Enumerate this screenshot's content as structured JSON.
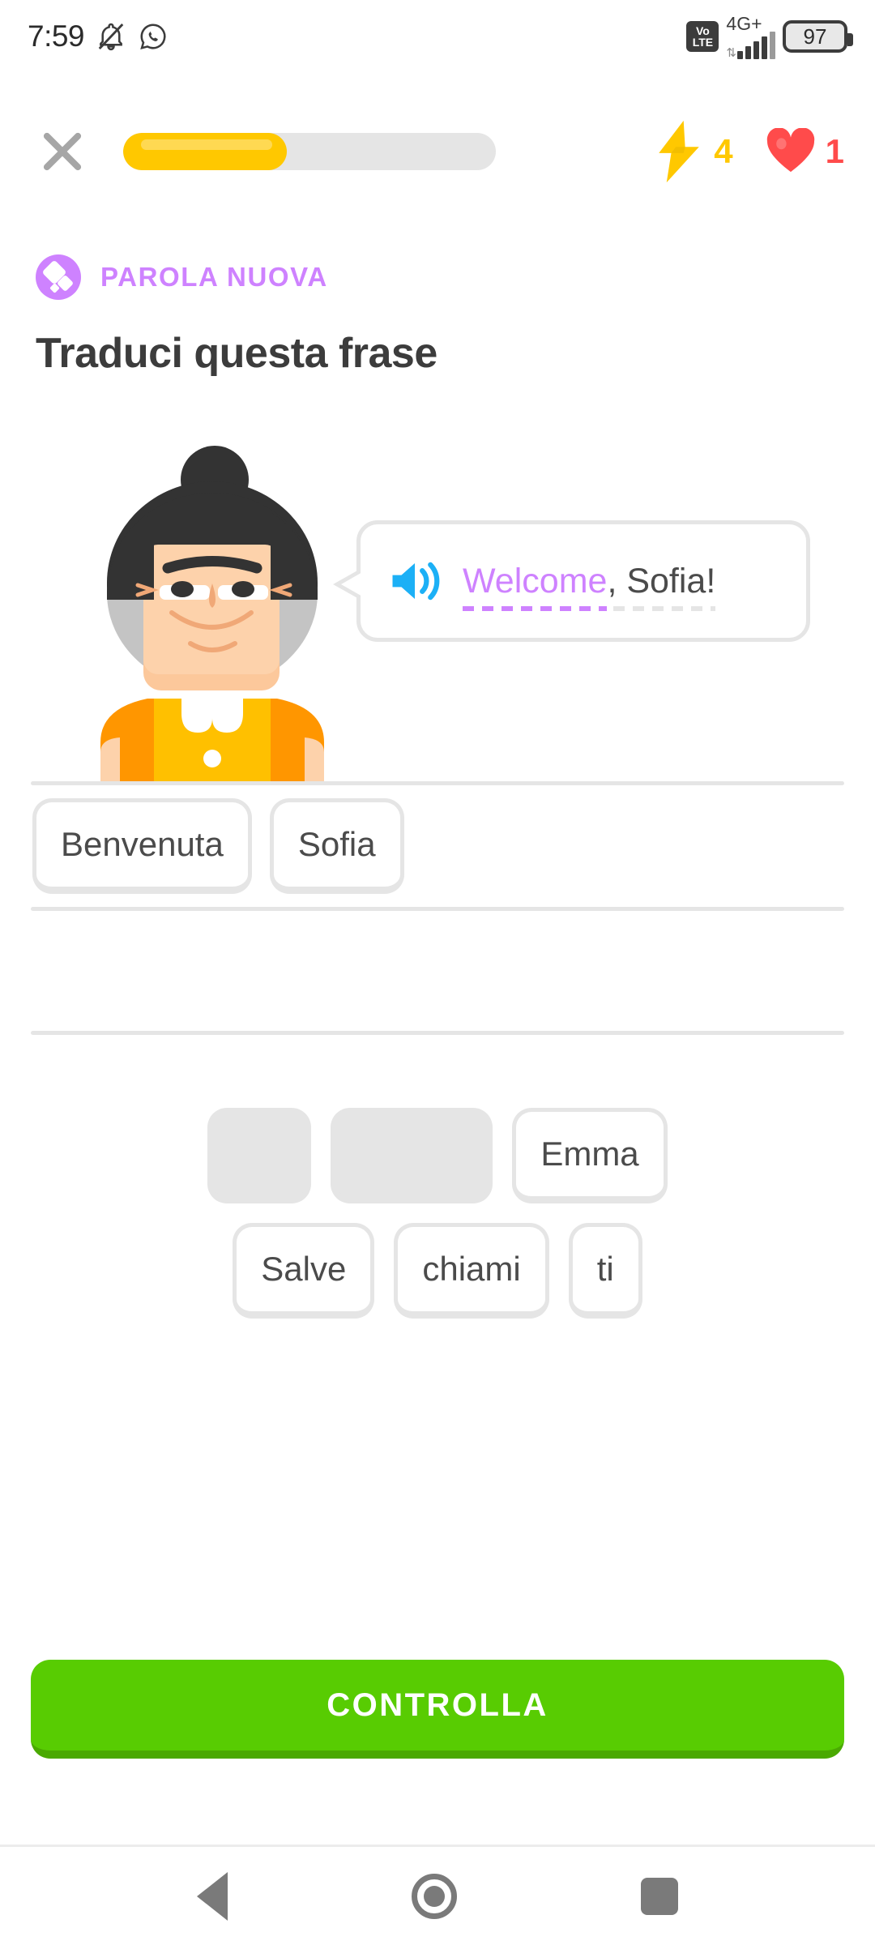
{
  "status_bar": {
    "time": "7:59",
    "icons": [
      "bell-muted-icon",
      "whatsapp-icon"
    ],
    "volte_top": "Vo",
    "volte_bottom": "LTE",
    "network": "4G+",
    "battery_level": "97"
  },
  "header": {
    "close_label": "×",
    "progress_percent": 44,
    "streak_count": "4",
    "hearts_count": "1"
  },
  "lesson": {
    "badge_label": "PAROLA NUOVA",
    "prompt_title": "Traduci questa frase",
    "bubble": {
      "highlighted_word": "Welcome",
      "rest_text": ", Sofia!"
    }
  },
  "answer": {
    "selected_tiles": [
      "Benvenuta",
      "Sofia"
    ]
  },
  "word_bank": {
    "row1": [
      {
        "label": "",
        "used": true
      },
      {
        "label": "",
        "used": true
      },
      {
        "label": "Emma",
        "used": false
      }
    ],
    "row2": [
      {
        "label": "Salve",
        "used": false
      },
      {
        "label": "chiami",
        "used": false
      },
      {
        "label": "ti",
        "used": false
      }
    ]
  },
  "footer": {
    "check_label": "CONTROLLA"
  },
  "colors": {
    "accent_green": "#58cc02",
    "progress_gold": "#ffc800",
    "heart_red": "#ff4b4b",
    "badge_purple": "#ce82ff",
    "text_dark": "#4b4b4b",
    "border_gray": "#e5e5e5"
  }
}
